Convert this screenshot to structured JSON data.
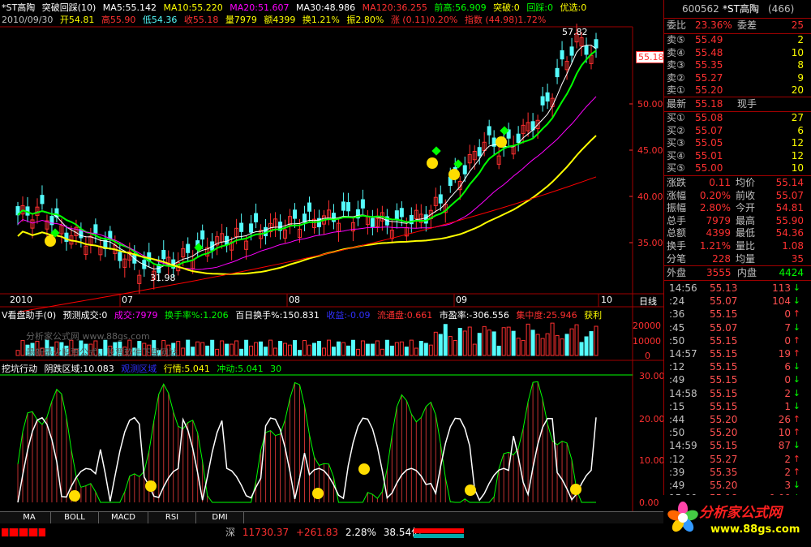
{
  "header": {
    "stock": "*ST高陶",
    "indicator": "突破回踩(10)",
    "ma5": "MA5:55.142",
    "ma10": "MA10:55.220",
    "ma20": "MA20:51.607",
    "ma30": "MA30:48.986",
    "ma120": "MA120:36.255",
    "prev_high": "前高:56.909",
    "breakthrough": "突破:0",
    "pullback": "回踩:0",
    "preferred": "优选:0"
  },
  "header2": {
    "date": "2010/09/30",
    "open": "开54.81",
    "high": "高55.90",
    "low": "低54.36",
    "close": "收55.18",
    "vol": "量7979",
    "amount": "额4399",
    "turnover": "换1.21%",
    "amplitude": "振2.80%",
    "change": "涨 (0.11)0.20%",
    "index": "指数 (44.98)1.72%"
  },
  "price_axis": [
    "50.00",
    "45.00",
    "40.00",
    "35.00"
  ],
  "price_current": "55.18",
  "peak_label": "57.82",
  "trough_label": "31.98",
  "date_labels": [
    "2010",
    "07",
    "08",
    "09",
    "10"
  ],
  "day_line_label": "日线",
  "vol_header": {
    "name": "V看盘助手(0)",
    "forecast": "预测成交:0",
    "vol": "成交:7979",
    "turn": "换手率%:1.206",
    "hundred": "百日换手%:150.831",
    "profit": "收益:-0.09",
    "float": "流通盘:0.661",
    "pe": "市盈率:-306.556",
    "conc": "集中度:25.946",
    "gain": "获利"
  },
  "vol_axis": [
    "20000",
    "10000",
    "0"
  ],
  "watermark": "分析家公式网 www.88gs.com",
  "watermark2": "最新最火股票公式，股票软件下载网站",
  "ind_header": {
    "name": "挖坑行动",
    "zone": "阴跌区域:10.083",
    "watch": "观测区域",
    "trend": "行情:5.041",
    "impulse": "冲动:5.041",
    "thirty": "30"
  },
  "ind_axis": [
    "30.00",
    "20.00",
    "10.00",
    "0.00"
  ],
  "tabs": [
    "MA",
    "BOLL",
    "MACD",
    "RSI",
    "DMI"
  ],
  "panel": {
    "code": "600562",
    "name": "*ST高陶",
    "count": "(466)",
    "ratio_label": "委比",
    "ratio": "23.36%",
    "diff_label": "委差",
    "diff": "25",
    "sells": [
      {
        "label": "卖⑤",
        "price": "55.49",
        "vol": "2"
      },
      {
        "label": "卖④",
        "price": "55.48",
        "vol": "10"
      },
      {
        "label": "卖③",
        "price": "55.35",
        "vol": "8"
      },
      {
        "label": "卖②",
        "price": "55.27",
        "vol": "9"
      },
      {
        "label": "卖①",
        "price": "55.20",
        "vol": "20"
      }
    ],
    "latest_label": "最新",
    "latest": "55.18",
    "hand_label": "现手",
    "buys": [
      {
        "label": "买①",
        "price": "55.08",
        "vol": "27"
      },
      {
        "label": "买②",
        "price": "55.07",
        "vol": "6"
      },
      {
        "label": "买③",
        "price": "55.05",
        "vol": "12"
      },
      {
        "label": "买④",
        "price": "55.01",
        "vol": "12"
      },
      {
        "label": "买⑤",
        "price": "55.00",
        "vol": "10"
      }
    ],
    "stats": [
      {
        "l1": "涨跌",
        "v1": "0.11",
        "l2": "均价",
        "v2": "55.14"
      },
      {
        "l1": "涨幅",
        "v1": "0.20%",
        "l2": "前收",
        "v2": "55.07"
      },
      {
        "l1": "振幅",
        "v1": "2.80%",
        "l2": "今开",
        "v2": "54.81"
      },
      {
        "l1": "总手",
        "v1": "7979",
        "l2": "最高",
        "v2": "55.90"
      },
      {
        "l1": "总额",
        "v1": "4399",
        "l2": "最低",
        "v2": "54.36"
      },
      {
        "l1": "换手",
        "v1": "1.21%",
        "l2": "量比",
        "v2": "1.08"
      },
      {
        "l1": "分笔",
        "v1": "228",
        "l2": "均量",
        "v2": "35"
      }
    ],
    "outer_label": "外盘",
    "outer": "3555",
    "inner_label": "内盘",
    "inner": "4424",
    "ticks": [
      {
        "t": "14:56",
        "p": "55.13",
        "v": "113",
        "a": "↓"
      },
      {
        "t": ":24",
        "p": "55.07",
        "v": "104",
        "a": "↓"
      },
      {
        "t": ":36",
        "p": "55.15",
        "v": "0",
        "a": "↑"
      },
      {
        "t": ":45",
        "p": "55.07",
        "v": "7",
        "a": "↓"
      },
      {
        "t": ":50",
        "p": "55.15",
        "v": "0",
        "a": "↑"
      },
      {
        "t": "14:57",
        "p": "55.15",
        "v": "19",
        "a": "↑"
      },
      {
        "t": ":12",
        "p": "55.15",
        "v": "6",
        "a": "↓"
      },
      {
        "t": ":49",
        "p": "55.15",
        "v": "0",
        "a": "↓"
      },
      {
        "t": "14:58",
        "p": "55.15",
        "v": "2",
        "a": "↓"
      },
      {
        "t": ":15",
        "p": "55.15",
        "v": "1",
        "a": "↓"
      },
      {
        "t": ":44",
        "p": "55.20",
        "v": "26",
        "a": "↑"
      },
      {
        "t": ":50",
        "p": "55.20",
        "v": "10",
        "a": "↑"
      },
      {
        "t": "14:59",
        "p": "55.15",
        "v": "87",
        "a": "↓"
      },
      {
        "t": ":12",
        "p": "55.27",
        "v": "2",
        "a": "↑"
      },
      {
        "t": ":39",
        "p": "55.35",
        "v": "2",
        "a": "↑"
      },
      {
        "t": ":49",
        "p": "55.20",
        "v": "3",
        "a": "↓"
      },
      {
        "t": "15:00",
        "p": "55.18",
        "v": "0.00",
        "a": "↓"
      }
    ]
  },
  "status": {
    "market": "深",
    "index": "11730.37",
    "change": "+261.83",
    "pct": "2.28%",
    "amount": "38.54亿"
  },
  "logo": {
    "title": "分析家公式网",
    "url": "www.88gs.com"
  },
  "chart_data": {
    "type": "table",
    "title": "",
    "price_axis_ticks": [
      35,
      40,
      45,
      50
    ],
    "volume_axis_ticks": [
      0,
      10000,
      20000
    ],
    "indicator_axis_ticks": [
      0,
      10,
      20,
      30
    ],
    "last_close": 55.18,
    "period_high": 57.82,
    "period_low": 31.98
  },
  "colors": {
    "up": "#ff3030",
    "down": "#54fcfc",
    "ma5": "#ffffff",
    "ma10": "#00ff00",
    "ma20": "#ff00ff",
    "ma30": "#ffff00",
    "ma120": "#ff0000",
    "label_yellow": "#ffff00"
  }
}
